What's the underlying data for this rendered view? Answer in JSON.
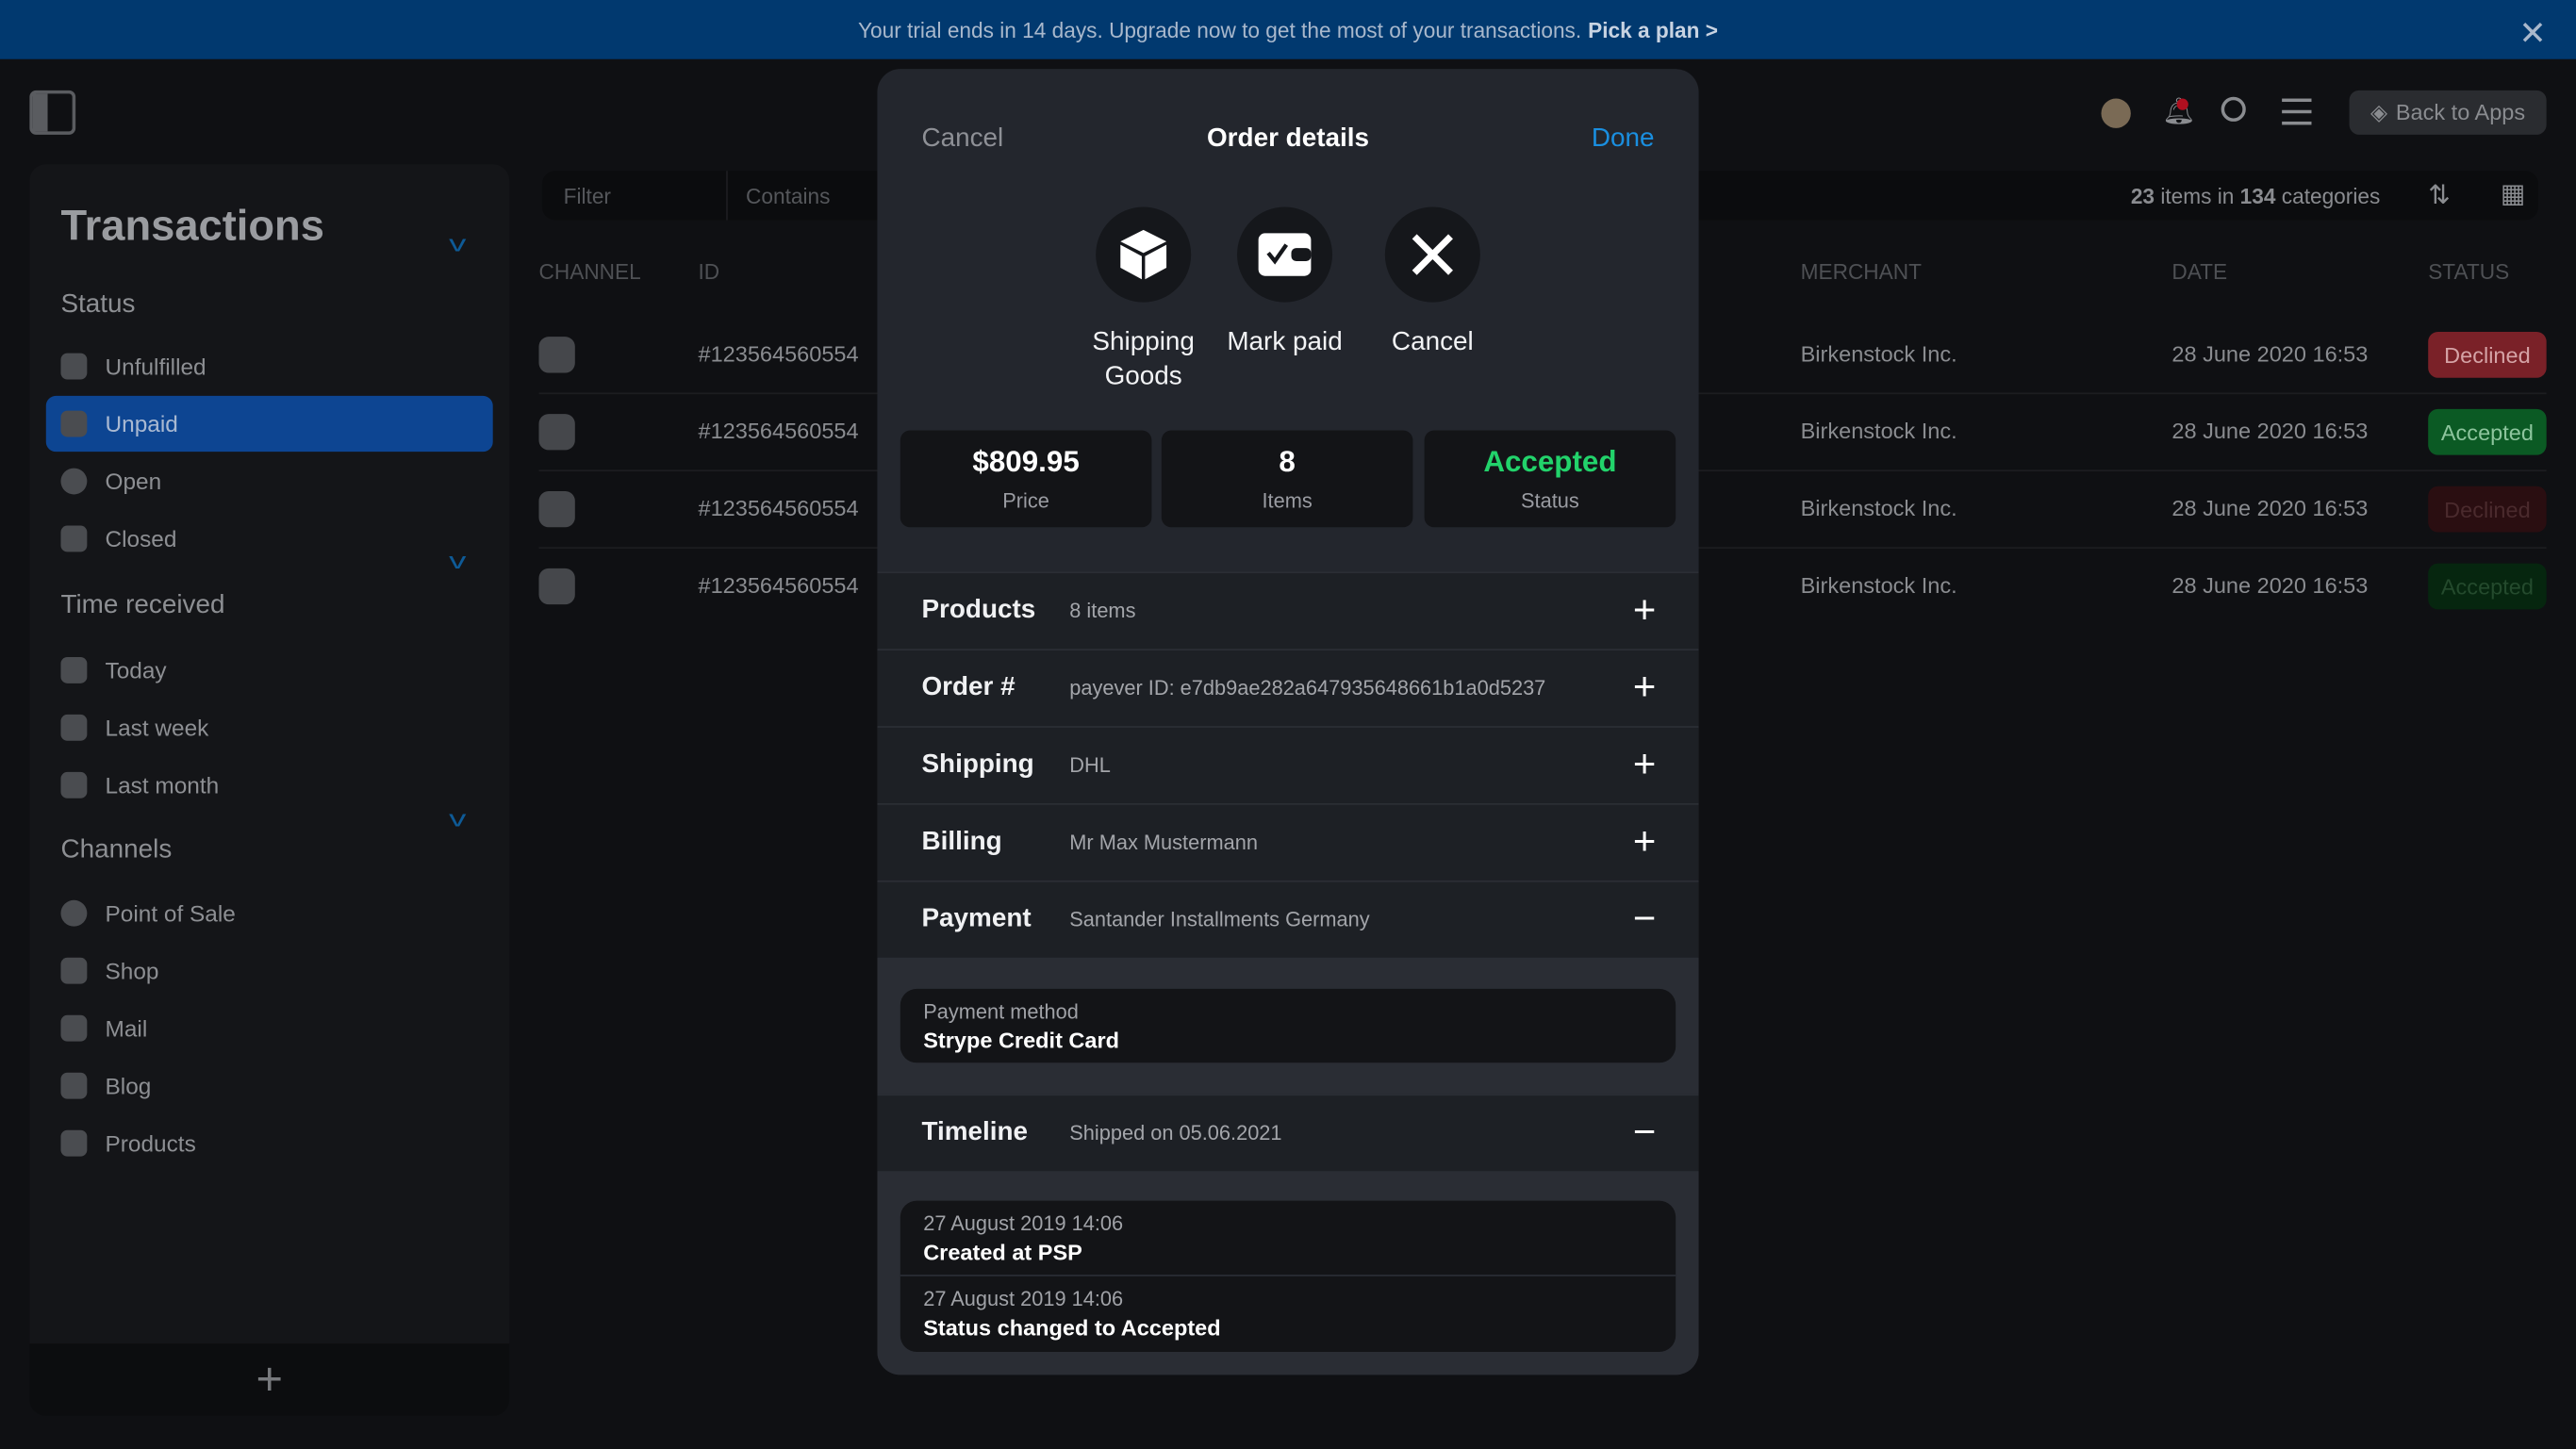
{
  "banner": {
    "text": "Your trial ends in 14 days. Upgrade now to get the most of your transactions.",
    "link": "Pick a plan >",
    "close": "✕"
  },
  "topbar": {
    "back_to_apps": "Back to Apps"
  },
  "sidebar": {
    "title": "Transactions",
    "status": {
      "label": "Status",
      "items": [
        {
          "label": "Unfulfilled"
        },
        {
          "label": "Unpaid",
          "selected": true
        },
        {
          "label": "Open"
        },
        {
          "label": "Closed"
        }
      ]
    },
    "time": {
      "label": "Time received",
      "items": [
        {
          "label": "Today"
        },
        {
          "label": "Last week"
        },
        {
          "label": "Last month"
        }
      ]
    },
    "channels": {
      "label": "Channels",
      "items": [
        {
          "label": "Point of Sale"
        },
        {
          "label": "Shop"
        },
        {
          "label": "Mail"
        },
        {
          "label": "Blog"
        },
        {
          "label": "Products"
        }
      ]
    },
    "add": "+"
  },
  "filter": {
    "field": "Filter",
    "operator": "Contains",
    "count": "23",
    "count_mid": " items in ",
    "categories": "134",
    "categories_suffix": " categories"
  },
  "table": {
    "headers": [
      "CHANNEL",
      "ID",
      "MERCHANT",
      "DATE",
      "STATUS"
    ],
    "rows": [
      {
        "id": "#123564560554",
        "merchant": "Birkenstock Inc.",
        "date": "28 June 2020 16:53",
        "status": "Declined"
      },
      {
        "id": "#123564560554",
        "merchant": "Birkenstock Inc.",
        "date": "28 June 2020 16:53",
        "status": "Accepted"
      },
      {
        "id": "#123564560554",
        "merchant": "Birkenstock Inc.",
        "date": "28 June 2020 16:53",
        "status": "Declined"
      },
      {
        "id": "#123564560554",
        "merchant": "Birkenstock Inc.",
        "date": "28 June 2020 16:53",
        "status": "Accepted"
      }
    ]
  },
  "colors": {
    "accent": "#1a8fe0",
    "declined": "#7a2128",
    "accepted": "#0b5a24",
    "accepted_text": "#22d36b",
    "banner": "#01396f"
  },
  "modal": {
    "cancel": "Cancel",
    "title": "Order details",
    "done": "Done",
    "actions": [
      {
        "label": "Shipping Goods",
        "icon": "box-icon"
      },
      {
        "label": "Mark paid",
        "icon": "wallet-check-icon"
      },
      {
        "label": "Cancel",
        "icon": "close-icon"
      }
    ],
    "stats": [
      {
        "value": "$809.95",
        "label": "Price"
      },
      {
        "value": "8",
        "label": "Items"
      },
      {
        "value": "Accepted",
        "label": "Status"
      }
    ],
    "sections": [
      {
        "title": "Products",
        "detail": "8 items",
        "toggle": "+"
      },
      {
        "title": "Order #",
        "detail": "payever ID: e7db9ae282a647935648661b1a0d5237",
        "toggle": "+"
      },
      {
        "title": "Shipping",
        "detail": "DHL",
        "toggle": "+"
      },
      {
        "title": "Billing",
        "detail": "Mr Max Mustermann",
        "toggle": "+"
      },
      {
        "title": "Payment",
        "detail": "Santander Installments Germany",
        "toggle": "−"
      }
    ],
    "payment_method": {
      "label": "Payment method",
      "value": "Strype Credit Card"
    },
    "timeline": {
      "title": "Timeline",
      "detail": "Shipped on 05.06.2021",
      "toggle": "−",
      "events": [
        {
          "date": "27 August 2019 14:06",
          "text": "Created at PSP"
        },
        {
          "date": "27 August 2019 14:06",
          "text": "Status changed to Accepted"
        }
      ]
    }
  }
}
